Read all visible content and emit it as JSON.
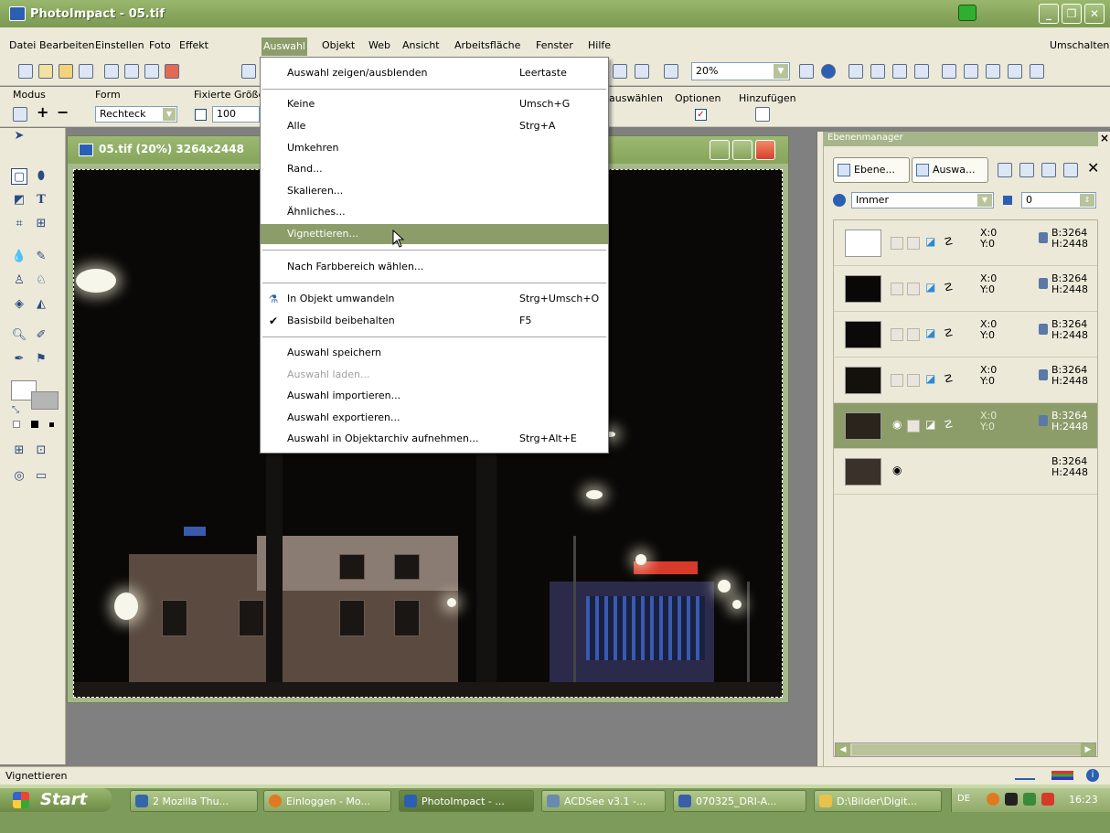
{
  "window": {
    "title": "PhotoImpact - 05.tif"
  },
  "menubar": {
    "items": [
      "Datei",
      "Bearbeiten",
      "Einstellen",
      "Foto",
      "Effekt",
      "Auswahl",
      "Objekt",
      "Web",
      "Ansicht",
      "Arbeitsfläche",
      "Fenster",
      "Hilfe"
    ],
    "right_label": "Umschalten"
  },
  "toolbar": {
    "zoom_value": "20%"
  },
  "attribute_bar": {
    "mode_label": "Modus",
    "form_label": "Form",
    "form_value": "Rechteck",
    "fixed_size_label": "Fixierte Größe",
    "fixed_size_value": "100",
    "select_label": "auswählen",
    "options_label": "Optionen",
    "add_label": "Hinzufügen"
  },
  "document": {
    "title": "05.tif (20%) 3264x2448"
  },
  "dropdown_menu": {
    "items": [
      {
        "label": "Auswahl zeigen/ausblenden",
        "shortcut": "Leertaste"
      },
      {
        "label": "Keine",
        "shortcut": "Umsch+G"
      },
      {
        "label": "Alle",
        "shortcut": "Strg+A"
      },
      {
        "label": "Umkehren",
        "shortcut": ""
      },
      {
        "label": "Rand...",
        "shortcut": ""
      },
      {
        "label": "Skalieren...",
        "shortcut": ""
      },
      {
        "label": "Ähnliches...",
        "shortcut": ""
      },
      {
        "label": "Vignettieren...",
        "shortcut": ""
      },
      {
        "label": "Nach Farbbereich wählen...",
        "shortcut": ""
      },
      {
        "label": "In Objekt umwandeln",
        "shortcut": "Strg+Umsch+O"
      },
      {
        "label": "Basisbild beibehalten",
        "shortcut": "F5"
      },
      {
        "label": "Auswahl speichern",
        "shortcut": ""
      },
      {
        "label": "Auswahl laden...",
        "shortcut": ""
      },
      {
        "label": "Auswahl importieren...",
        "shortcut": ""
      },
      {
        "label": "Auswahl exportieren...",
        "shortcut": ""
      },
      {
        "label": "Auswahl in Objektarchiv aufnehmen...",
        "shortcut": "Strg+Alt+E"
      }
    ]
  },
  "layer_panel": {
    "title": "Ebenenmanager",
    "tab_layers": "Ebene...",
    "tab_selection": "Auswa...",
    "blend_mode": "Immer",
    "opacity_value": "0",
    "layers": [
      {
        "x": "X:0",
        "y": "Y:0",
        "b": "B:3264",
        "h": "H:2448"
      },
      {
        "x": "X:0",
        "y": "Y:0",
        "b": "B:3264",
        "h": "H:2448"
      },
      {
        "x": "X:0",
        "y": "Y:0",
        "b": "B:3264",
        "h": "H:2448"
      },
      {
        "x": "X:0",
        "y": "Y:0",
        "b": "B:3264",
        "h": "H:2448"
      },
      {
        "x": "X:0",
        "y": "Y:0",
        "b": "B:3264",
        "h": "H:2448"
      },
      {
        "x": "",
        "y": "",
        "b": "B:3264",
        "h": "H:2448"
      }
    ]
  },
  "statusbar": {
    "text": "Vignettieren"
  },
  "taskbar": {
    "start_label": "Start",
    "tasks": [
      {
        "label": "2 Mozilla Thu..."
      },
      {
        "label": "Einloggen - Mo..."
      },
      {
        "label": "PhotoImpact - ..."
      },
      {
        "label": "ACDSee v3.1 -..."
      },
      {
        "label": "070325_DRI-A..."
      },
      {
        "label": "D:\\Bilder\\Digit..."
      }
    ],
    "language": "DE",
    "clock": "16:23"
  },
  "colors": {
    "accent": "#8d9d6a",
    "titlebar": "#86a45a",
    "chrome": "#ece9d8"
  }
}
